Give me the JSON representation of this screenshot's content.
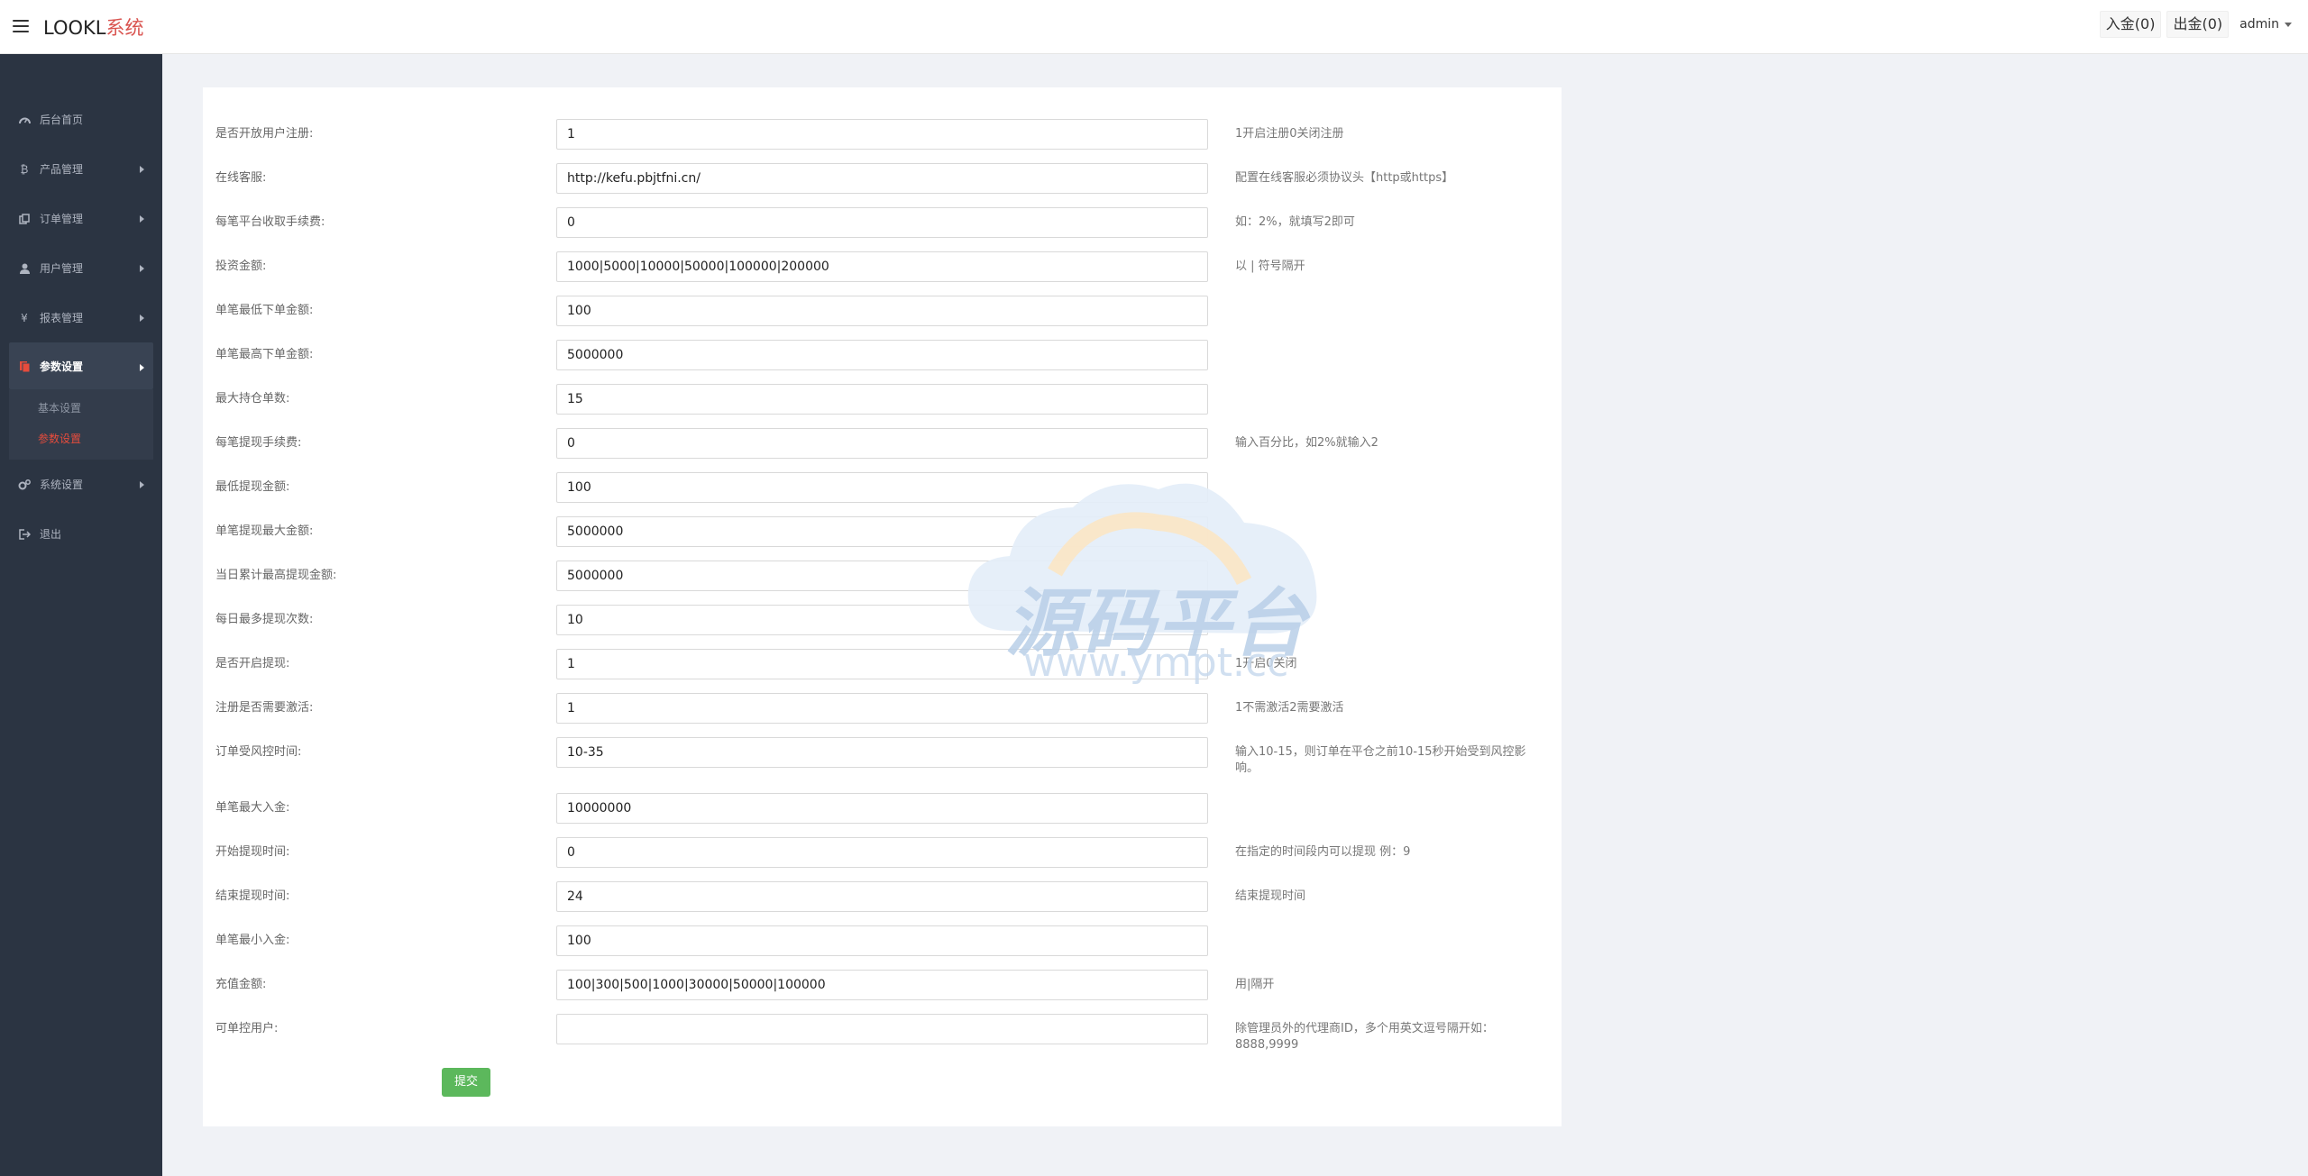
{
  "header": {
    "brand_main": "LOOKL",
    "brand_accent": "系统",
    "deposit_label": "入金(0)",
    "withdraw_label": "出金(0)",
    "user_label": "admin"
  },
  "sidebar": {
    "items": [
      {
        "label": "后台首页",
        "icon": "dashboard-icon"
      },
      {
        "label": "产品管理",
        "icon": "bitcoin-icon"
      },
      {
        "label": "订单管理",
        "icon": "copy-icon"
      },
      {
        "label": "用户管理",
        "icon": "user-icon"
      },
      {
        "label": "报表管理",
        "icon": "yen-icon"
      },
      {
        "label": "参数设置",
        "icon": "files-icon"
      },
      {
        "label": "系统设置",
        "icon": "gears-icon"
      },
      {
        "label": "退出",
        "icon": "sign-out-icon"
      }
    ],
    "sub_items": [
      "基本设置",
      "参数设置"
    ]
  },
  "form": {
    "rows": [
      {
        "label": "是否开放用户注册:",
        "value": "1",
        "hint": "1开启注册0关闭注册"
      },
      {
        "label": "在线客服:",
        "value": "http://kefu.pbjtfni.cn/",
        "hint": "配置在线客服必须协议头【http或https】"
      },
      {
        "label": "每笔平台收取手续费:",
        "value": "0",
        "hint": "如：2%，就填写2即可"
      },
      {
        "label": "投资金额:",
        "value": "1000|5000|10000|50000|100000|200000",
        "hint": "以 | 符号隔开"
      },
      {
        "label": "单笔最低下单金额:",
        "value": "100",
        "hint": ""
      },
      {
        "label": "单笔最高下单金额:",
        "value": "5000000",
        "hint": ""
      },
      {
        "label": "最大持仓单数:",
        "value": "15",
        "hint": ""
      },
      {
        "label": "每笔提现手续费:",
        "value": "0",
        "hint": "输入百分比，如2%就输入2"
      },
      {
        "label": "最低提现金额:",
        "value": "100",
        "hint": ""
      },
      {
        "label": "单笔提现最大金额:",
        "value": "5000000",
        "hint": ""
      },
      {
        "label": "当日累计最高提现金额:",
        "value": "5000000",
        "hint": ""
      },
      {
        "label": "每日最多提现次数:",
        "value": "10",
        "hint": ""
      },
      {
        "label": "是否开启提现:",
        "value": "1",
        "hint": "1开启0关闭"
      },
      {
        "label": "注册是否需要激活:",
        "value": "1",
        "hint": "1不需激活2需要激活"
      },
      {
        "label": "订单受风控时间:",
        "value": "10-35",
        "hint": "输入10-15，则订单在平仓之前10-15秒开始受到风控影响。"
      },
      {
        "label": "单笔最大入金:",
        "value": "10000000",
        "hint": ""
      },
      {
        "label": "开始提现时间:",
        "value": "0",
        "hint": "在指定的时间段内可以提现 例：9"
      },
      {
        "label": "结束提现时间:",
        "value": "24",
        "hint": "结束提现时间"
      },
      {
        "label": "单笔最小入金:",
        "value": "100",
        "hint": ""
      },
      {
        "label": "充值金额:",
        "value": "100|300|500|1000|30000|50000|100000",
        "hint": "用|隔开"
      },
      {
        "label": "可单控用户:",
        "value": "",
        "hint": "除管理员外的代理商ID，多个用英文逗号隔开如：8888,9999"
      }
    ],
    "submit_label": "提交"
  },
  "watermark": {
    "title": "源码平台",
    "url": "www.ympt.cc"
  }
}
